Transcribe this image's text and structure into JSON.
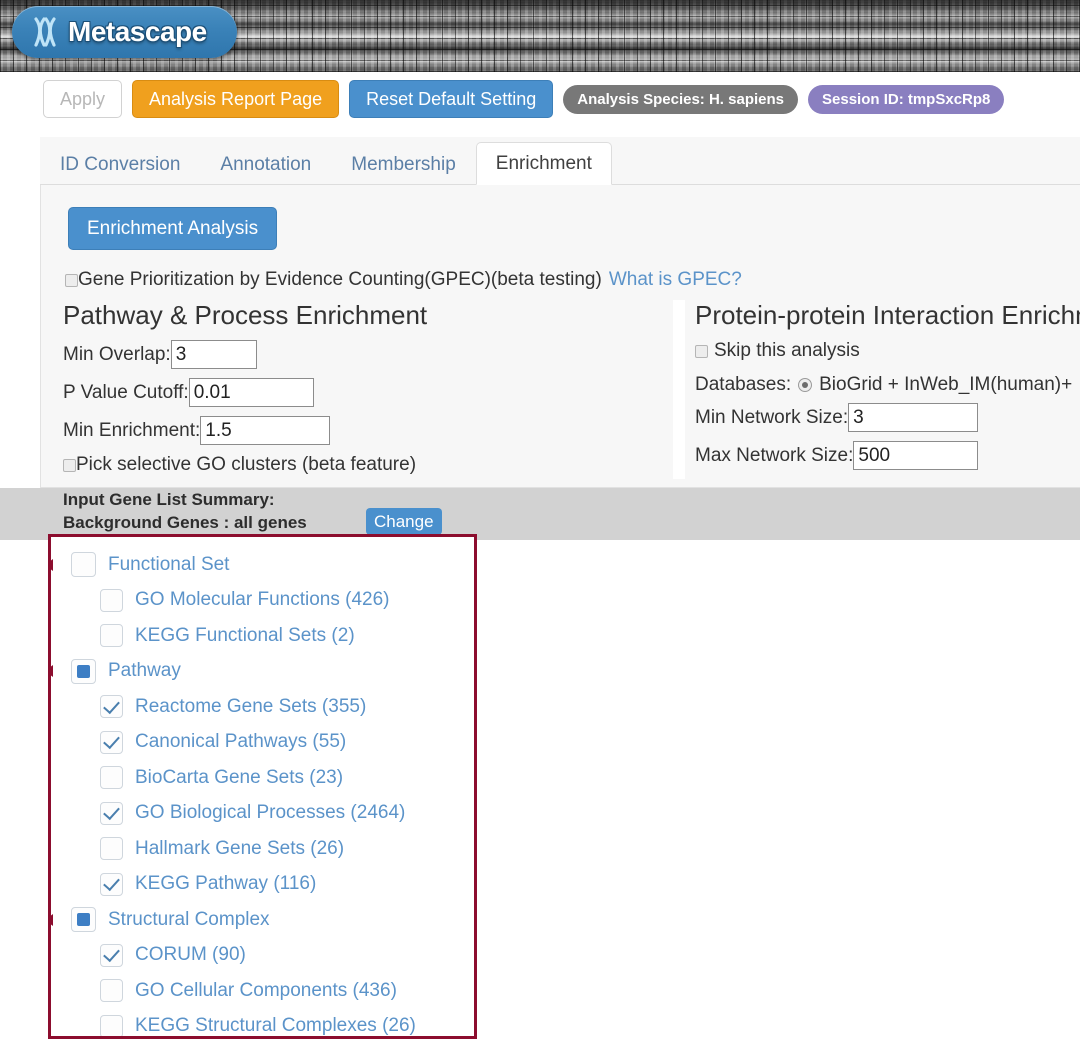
{
  "header": {
    "logo_text": "Metascape",
    "logo_icon": "chromosome-icon"
  },
  "toolbar": {
    "apply_label": "Apply",
    "report_label": "Analysis Report Page",
    "reset_label": "Reset Default Setting",
    "species_label": "Analysis Species: H. sapiens",
    "session_label": "Session ID: tmpSxcRp8",
    "colors": {
      "report": "#f0a01e",
      "reset": "#4a90cd",
      "species": "#787878",
      "session": "#8a7fc0"
    }
  },
  "tabs": [
    {
      "label": "ID Conversion",
      "active": false
    },
    {
      "label": "Annotation",
      "active": false
    },
    {
      "label": "Membership",
      "active": false
    },
    {
      "label": "Enrichment",
      "active": true
    }
  ],
  "enrichment": {
    "analysis_button": "Enrichment Analysis",
    "gpec_label": "Gene Prioritization by Evidence Counting(GPEC)(beta testing)",
    "gpec_link": "What is GPEC?",
    "gpec_checked": false,
    "pathway_panel": {
      "title": "Pathway & Process Enrichment",
      "fields": [
        {
          "label": "Min Overlap:",
          "value": "3"
        },
        {
          "label": "P Value Cutoff:",
          "value": "0.01"
        },
        {
          "label": "Min Enrichment:",
          "value": "1.5"
        }
      ],
      "go_clusters_label": "Pick selective GO clusters (beta feature)",
      "go_clusters_checked": false
    },
    "ppi_panel": {
      "title": "Protein-protein Interaction Enrichm",
      "skip_label": "Skip this analysis",
      "skip_checked": false,
      "databases_label": "Databases:",
      "databases_value": "BioGrid + InWeb_IM(human)+",
      "fields": [
        {
          "label": "Min Network Size:",
          "value": "3"
        },
        {
          "label": "Max Network Size:",
          "value": "500"
        }
      ]
    }
  },
  "summary_bar": {
    "line1": "Input Gene List Summary:",
    "line2": "Background Genes : all genes",
    "change_label": "Change"
  },
  "tree": {
    "highlight_color": "#8c0d2e",
    "groups": [
      {
        "label": "Functional Set",
        "state": "unchecked",
        "items": [
          {
            "label": "GO Molecular Functions (426)",
            "state": "unchecked"
          },
          {
            "label": "KEGG Functional Sets (2)",
            "state": "unchecked"
          }
        ]
      },
      {
        "label": "Pathway",
        "state": "partial",
        "items": [
          {
            "label": "Reactome Gene Sets (355)",
            "state": "checked"
          },
          {
            "label": "Canonical Pathways (55)",
            "state": "checked"
          },
          {
            "label": "BioCarta Gene Sets (23)",
            "state": "unchecked"
          },
          {
            "label": "GO Biological Processes (2464)",
            "state": "checked"
          },
          {
            "label": "Hallmark Gene Sets (26)",
            "state": "unchecked"
          },
          {
            "label": "KEGG Pathway (116)",
            "state": "checked"
          }
        ]
      },
      {
        "label": "Structural Complex",
        "state": "partial",
        "items": [
          {
            "label": "CORUM (90)",
            "state": "checked"
          },
          {
            "label": "GO Cellular Components (436)",
            "state": "unchecked"
          },
          {
            "label": "KEGG Structural Complexes (26)",
            "state": "unchecked"
          }
        ]
      }
    ]
  }
}
